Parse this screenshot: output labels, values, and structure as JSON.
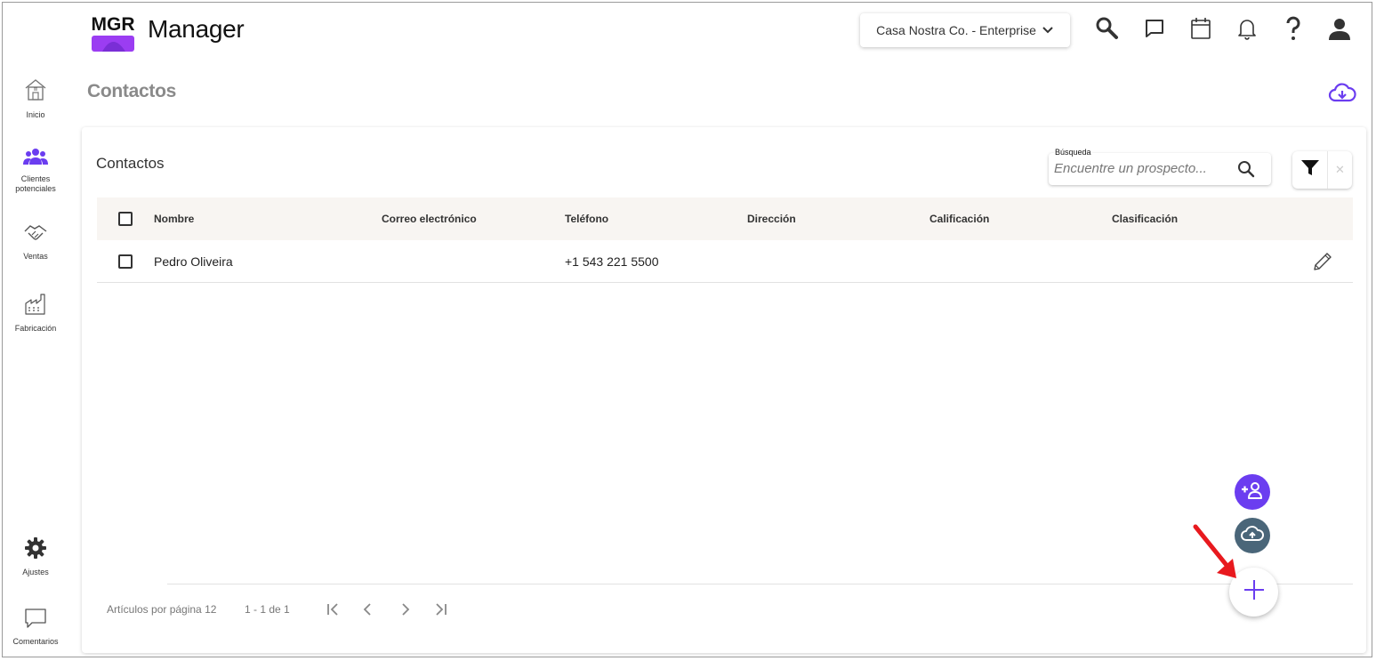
{
  "app": {
    "logo_text": "MGR",
    "brand": "Manager",
    "organization": "Casa Nostra Co. - Enterprise"
  },
  "sidebar": {
    "items": [
      {
        "label": "Inicio",
        "icon": "home-icon"
      },
      {
        "label": "Clientes potenciales",
        "icon": "people-icon"
      },
      {
        "label": "Ventas",
        "icon": "handshake-icon"
      },
      {
        "label": "Fabricación",
        "icon": "factory-icon"
      },
      {
        "label": "Ajustes",
        "icon": "gear-icon"
      },
      {
        "label": "Comentarios",
        "icon": "comment-icon"
      }
    ]
  },
  "page": {
    "title": "Contactos"
  },
  "card": {
    "title": "Contactos",
    "search": {
      "label": "Búsqueda",
      "placeholder": "Encuentre un prospecto..."
    },
    "clear_label": "✕"
  },
  "table": {
    "columns": [
      "Nombre",
      "Correo electrónico",
      "Teléfono",
      "Dirección",
      "Calificación",
      "Clasificación"
    ],
    "rows": [
      {
        "nombre": "Pedro Oliveira",
        "correo": "",
        "telefono": "+1 543 221 5500",
        "direccion": "",
        "calificacion": "",
        "clasificacion": ""
      }
    ]
  },
  "pagination": {
    "per_page_label": "Artículos por página 12",
    "range": "1 - 1 de 1"
  },
  "colors": {
    "accent": "#6b3df0",
    "upload_fab": "#4a6679",
    "arrow": "#e8191e"
  }
}
